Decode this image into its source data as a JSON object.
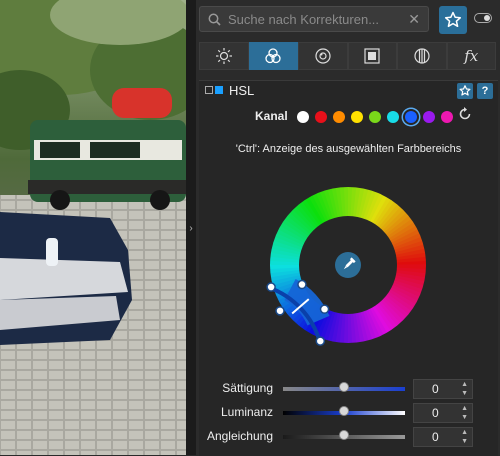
{
  "search": {
    "placeholder": "Suche nach Korrekturen..."
  },
  "tabs": [
    {
      "name": "light",
      "icon": "sun-icon"
    },
    {
      "name": "color",
      "icon": "color-circles-icon",
      "active": true
    },
    {
      "name": "detail",
      "icon": "lens-icon"
    },
    {
      "name": "geometry",
      "icon": "frame-icon"
    },
    {
      "name": "local",
      "icon": "grid-circle-icon"
    },
    {
      "name": "effects",
      "icon": "fx-icon",
      "label": "fx"
    }
  ],
  "hsl": {
    "title": "HSL",
    "help": "?",
    "channel_label": "Kanal",
    "channels": [
      {
        "name": "white",
        "color": "#ffffff"
      },
      {
        "name": "red",
        "color": "#e8101a"
      },
      {
        "name": "orange",
        "color": "#ff8c00"
      },
      {
        "name": "yellow",
        "color": "#ffe000"
      },
      {
        "name": "green",
        "color": "#7ad81a"
      },
      {
        "name": "cyan",
        "color": "#18dce8"
      },
      {
        "name": "blue",
        "color": "#1a60ff",
        "selected": true
      },
      {
        "name": "purple",
        "color": "#9a1aee"
      },
      {
        "name": "magenta",
        "color": "#ee18b0"
      }
    ],
    "hint": "'Ctrl': Anzeige des ausgewählten Farbbereichs",
    "sliders": [
      {
        "label": "Sättigung",
        "value": "0",
        "level": 0.5
      },
      {
        "label": "Luminanz",
        "value": "0",
        "level": 0.5
      },
      {
        "label": "Angleichung",
        "value": "0",
        "level": 0.5
      }
    ]
  },
  "colors": {
    "accent": "#2c6e98",
    "panel": "#2b2b2b"
  }
}
